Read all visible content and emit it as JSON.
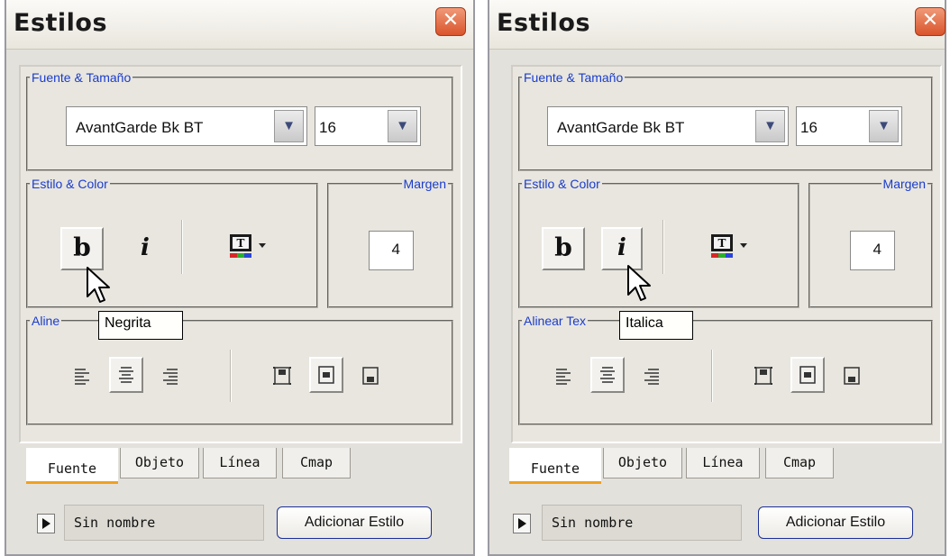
{
  "panels": [
    {
      "title": "Estilos",
      "font_group_label": "Fuente & Tamaño",
      "font_name": "AvantGarde Bk BT",
      "font_size": "16",
      "style_group_label": "Estilo & Color",
      "bold_glyph": "b",
      "italic_glyph": "i",
      "margin_label": "Margen",
      "margin_value": "4",
      "align_group_label": "Alinear Texto",
      "align_label_visible": "Aline",
      "tooltip": "Negrita",
      "tabs": [
        "Fuente",
        "Objeto",
        "Línea",
        "Cmap"
      ],
      "style_name": "Sin nombre",
      "add_button": "Adicionar Estilo"
    },
    {
      "title": "Estilos",
      "font_group_label": "Fuente & Tamaño",
      "font_name": "AvantGarde Bk BT",
      "font_size": "16",
      "style_group_label": "Estilo & Color",
      "bold_glyph": "b",
      "italic_glyph": "i",
      "margin_label": "Margen",
      "margin_value": "4",
      "align_label_visible": "Alinear Tex",
      "tooltip": "Italica",
      "tabs": [
        "Fuente",
        "Objeto",
        "Línea",
        "Cmap"
      ],
      "style_name": "Sin nombre",
      "add_button": "Adicionar Estilo"
    }
  ],
  "colors": {
    "legend_text": "#1a3ccc",
    "close_button": "#d9542c",
    "active_tab_underline": "#f0a020"
  },
  "icons": [
    "close-icon",
    "dropdown-arrow-icon",
    "text-color-icon",
    "align-left-icon",
    "align-center-icon",
    "align-right-icon",
    "valign-top-icon",
    "valign-middle-icon",
    "valign-bottom-icon",
    "play-icon",
    "mouse-cursor-icon"
  ]
}
